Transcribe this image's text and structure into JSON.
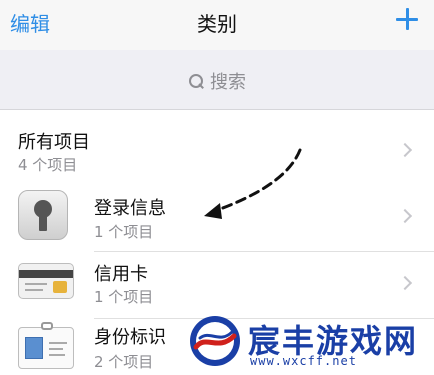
{
  "navbar": {
    "edit_label": "编辑",
    "title": "类别",
    "add_icon": "plus-icon",
    "accent_color": "#2f8ee6"
  },
  "search": {
    "placeholder": "搜索",
    "icon": "search-icon"
  },
  "all_items": {
    "title": "所有项目",
    "count": "4 个项目"
  },
  "categories": [
    {
      "title": "登录信息",
      "count": "1 个项目",
      "icon": "keyhole-icon"
    },
    {
      "title": "信用卡",
      "count": "1 个项目",
      "icon": "credit-card-icon"
    },
    {
      "title": "身份标识",
      "count": "2 个项目",
      "icon": "id-badge-icon"
    }
  ],
  "watermark": {
    "text": "宸丰游戏网",
    "url": "www.wxcff.net"
  }
}
